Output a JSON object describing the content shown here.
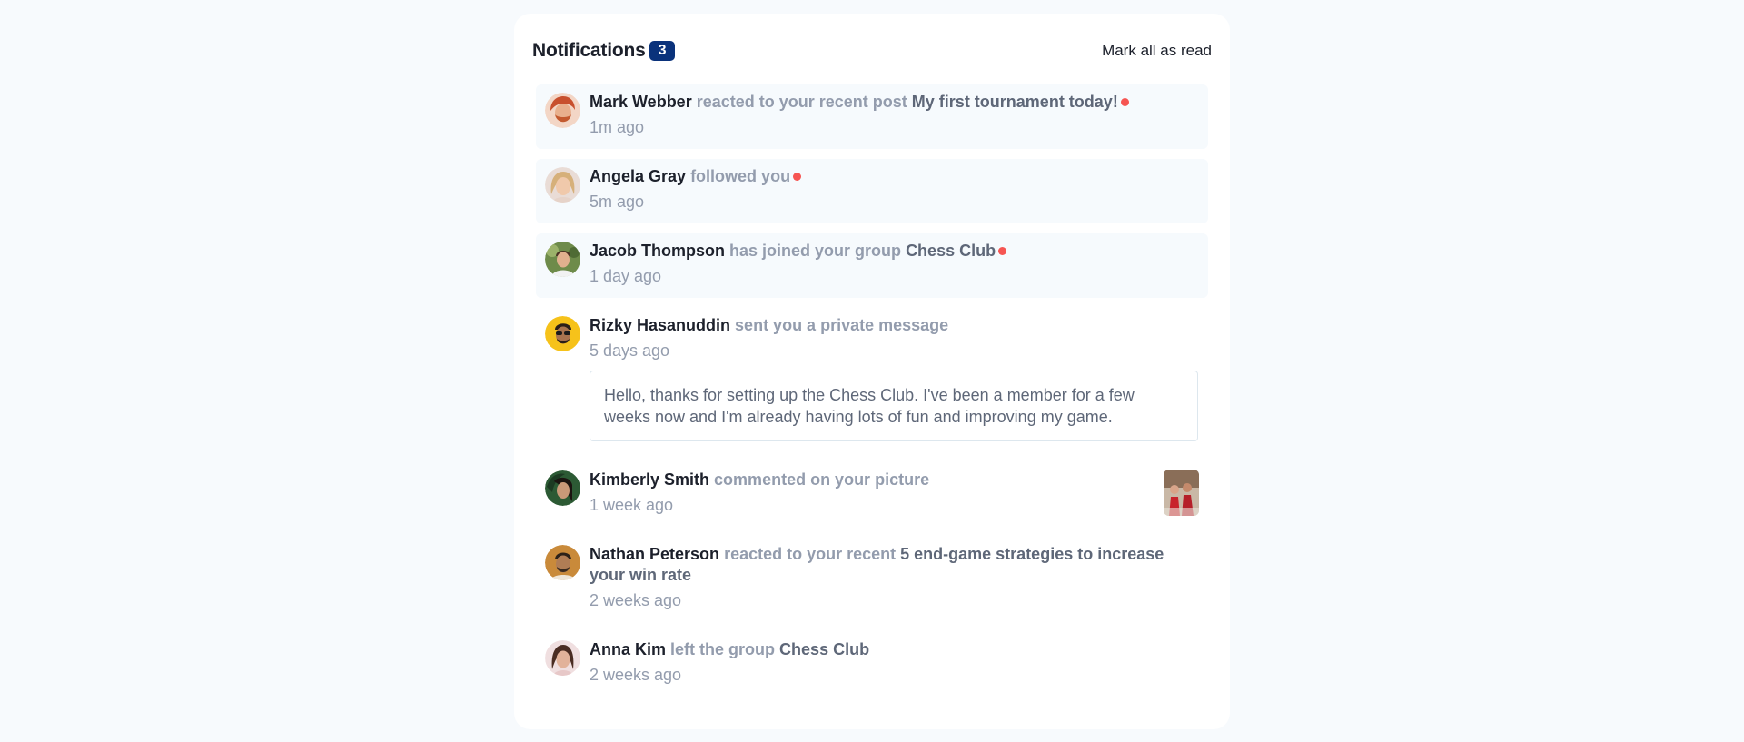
{
  "header": {
    "title": "Notifications",
    "count": "3",
    "mark_all": "Mark all as read"
  },
  "colors": {
    "badge": "#0a327b",
    "unread_bg": "#f6fafd",
    "dot": "#f65552",
    "name": "#1c202b",
    "muted": "#939cad",
    "target": "#5e6778"
  },
  "notifications": [
    {
      "name": "Mark Webber",
      "action": "reacted to your recent post",
      "target": "My first tournament today!",
      "time": "1m ago",
      "unread": true
    },
    {
      "name": "Angela Gray",
      "action": "followed you",
      "target": "",
      "time": "5m ago",
      "unread": true
    },
    {
      "name": "Jacob Thompson",
      "action": "has joined your group",
      "target": "Chess Club",
      "time": "1 day ago",
      "unread": true
    },
    {
      "name": "Rizky Hasanuddin",
      "action": "sent you a private message",
      "target": "",
      "time": "5 days ago",
      "unread": false,
      "message": "Hello, thanks for setting up the Chess Club. I've been a member for a few weeks now and I'm already having lots of fun and improving my game."
    },
    {
      "name": "Kimberly Smith",
      "action": "commented on your picture",
      "target": "",
      "time": "1 week ago",
      "unread": false
    },
    {
      "name": "Nathan Peterson",
      "action": "reacted to your recent",
      "target": "5 end-game strategies to increase your win rate",
      "time": "2 weeks ago",
      "unread": false
    },
    {
      "name": "Anna Kim",
      "action": "left the group",
      "target": "Chess Club",
      "time": "2 weeks ago",
      "unread": false
    }
  ]
}
